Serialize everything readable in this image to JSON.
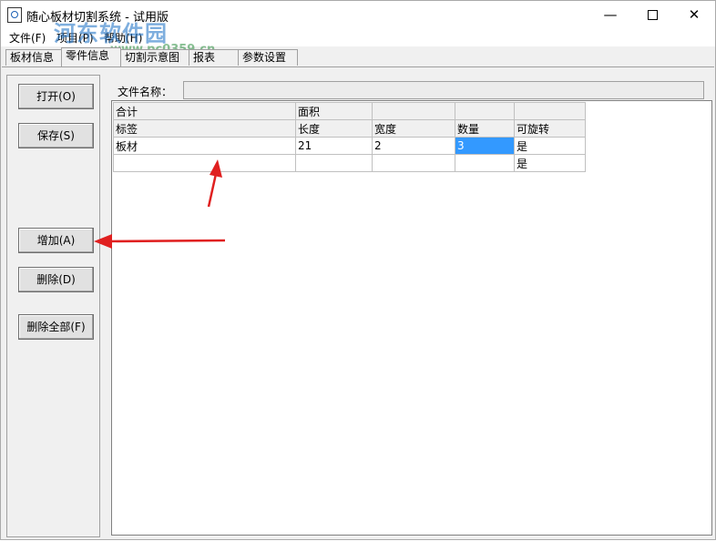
{
  "window": {
    "title": "随心板材切割系统 - 试用版",
    "controls": {
      "minimize": "—",
      "maximize": "",
      "close": "✕"
    }
  },
  "watermark": {
    "text": "河东软件园",
    "url": "www.pc0359.cn"
  },
  "menu": [
    "文件(F)",
    "项目(P)",
    "帮助(H)"
  ],
  "tabs": [
    {
      "label": "板材信息",
      "active": false
    },
    {
      "label": "零件信息",
      "active": true
    },
    {
      "label": "切割示意图",
      "active": false
    },
    {
      "label": "报表",
      "active": false
    },
    {
      "label": "参数设置",
      "active": false
    }
  ],
  "buttons": {
    "open": "打开(O)",
    "save": "保存(S)",
    "add": "增加(A)",
    "delete": "删除(D)",
    "delete_all": "删除全部(F)"
  },
  "file_name_label": "文件名称：",
  "file_name_value": "",
  "grid": {
    "summary_row": [
      "合计",
      "面积",
      "",
      "",
      ""
    ],
    "header_row": [
      "标签",
      "长度",
      "宽度",
      "数量",
      "可旋转"
    ],
    "rows": [
      [
        "板材",
        "21",
        "2",
        "3",
        "是"
      ],
      [
        "",
        "",
        "",
        "",
        "是"
      ]
    ]
  },
  "accent_colors": {
    "selection": "#3399ff",
    "annotation_arrow": "#e02020"
  }
}
